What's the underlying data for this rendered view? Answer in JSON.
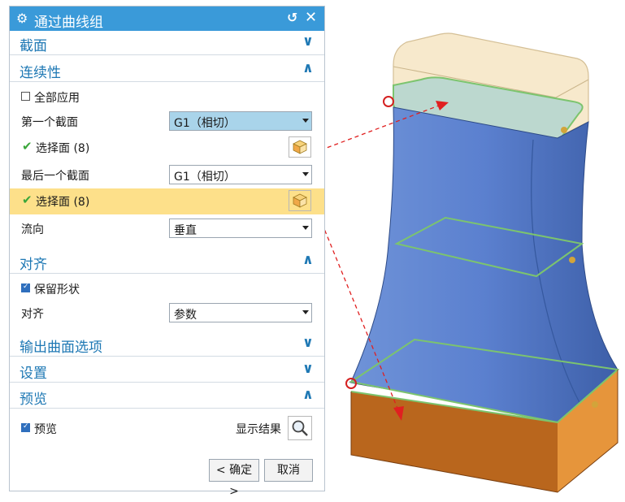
{
  "dialog": {
    "title": "通过曲线组",
    "icons": [
      "gear-icon",
      "reset-icon",
      "close-icon"
    ],
    "title_bg": "#3a9ad9"
  },
  "sections": {
    "section": {
      "label": "截面",
      "state": "collapsed"
    },
    "continuity": {
      "label": "连续性",
      "state": "expanded",
      "apply_all": {
        "label": "全部应用",
        "checked": false
      },
      "first_section_label": "第一个截面",
      "first_section_value": "G1（相切）",
      "select_face_1": "选择面 (8)",
      "last_section_label": "最后一个截面",
      "last_section_value": "G1（相切）",
      "select_face_2": "选择面 (8)",
      "flow_label": "流向",
      "flow_value": "垂直"
    },
    "alignment": {
      "label": "对齐",
      "state": "expanded",
      "preserve_shape": {
        "label": "保留形状",
        "checked": true
      },
      "align_label": "对齐",
      "align_value": "参数"
    },
    "output_options": {
      "label": "输出曲面选项",
      "state": "collapsed"
    },
    "settings": {
      "label": "设置",
      "state": "collapsed"
    },
    "preview": {
      "label": "预览",
      "state": "expanded",
      "preview_check": {
        "label": "预览",
        "checked": true
      },
      "show_result": "显示结果"
    }
  },
  "buttons": {
    "ok": "< 确定 >",
    "cancel": "取消"
  },
  "colors": {
    "accent": "#1e78b4",
    "highlight_row": "#fde08a",
    "annotation_red": "#e02020",
    "surface_blue": "#4f78c8",
    "top_block": "#f6e7c8",
    "bottom_block": "#e28a2e",
    "curve_green": "#7cc46e"
  }
}
